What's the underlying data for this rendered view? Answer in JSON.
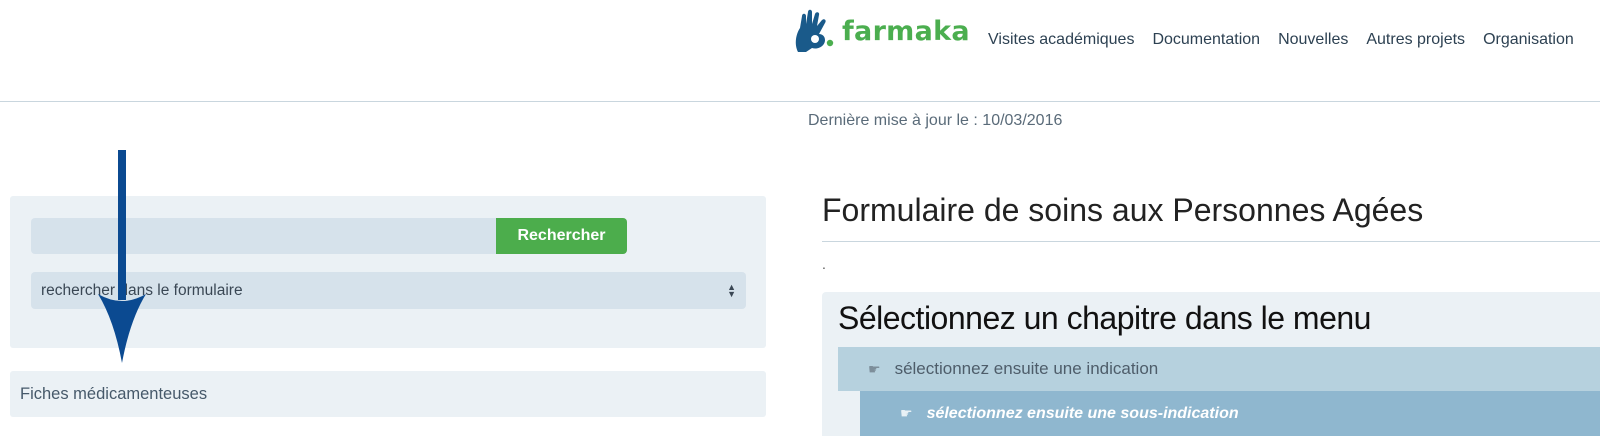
{
  "header": {
    "brand": "farmaka",
    "logo_icon": "hand-logo-icon",
    "nav": [
      {
        "label": "Visites académiques"
      },
      {
        "label": "Documentation"
      },
      {
        "label": "Nouvelles"
      },
      {
        "label": "Autres projets"
      },
      {
        "label": "Organisation"
      }
    ]
  },
  "updated_text": "Dernière mise à jour le : 10/03/2016",
  "search": {
    "input_value": "",
    "button_label": "Rechercher",
    "scope_selected": "rechercher dans le formulaire"
  },
  "fiches_label": "Fiches médicamenteuses",
  "main": {
    "title": "Formulaire de soins aux Personnes Agées",
    "dot": ".",
    "chapter_heading": "Sélectionnez un chapitre dans le menu",
    "indication_label": "sélectionnez ensuite une indication",
    "sub_indication_label": "sélectionnez ensuite une sous-indication",
    "hand_icon": "☛"
  },
  "colors": {
    "brand_green": "#4bae4f",
    "logo_blue": "#1a5a8a",
    "annotation_arrow": "#0b4a91",
    "indication_bg": "#b6d1de",
    "sub_indication_bg": "#8fb7cf"
  }
}
